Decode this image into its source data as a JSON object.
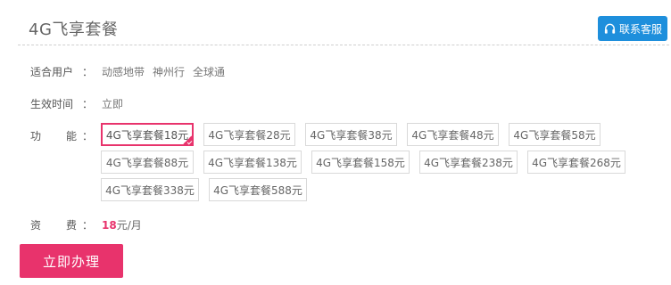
{
  "header": {
    "title": "4G飞享套餐",
    "service_label": "联系客服",
    "service_icon": "headset-icon",
    "brand_blue": "#1e8fdc"
  },
  "fields": {
    "users_label_a": "适合用户",
    "users_colon": "：",
    "users": [
      "动感地带",
      "神州行",
      "全球通"
    ],
    "effective_label": "生效时间",
    "effective_colon": "：",
    "effective_value": "立即",
    "function_label_a": "功",
    "function_label_b": "能",
    "function_colon": "：",
    "fee_label_a": "资",
    "fee_label_b": "费",
    "fee_colon": "：",
    "fee_value": "18",
    "fee_unit": "元/月"
  },
  "plans": [
    [
      {
        "label": "4G飞享套餐18元",
        "selected": true
      },
      {
        "label": "4G飞享套餐28元",
        "selected": false
      },
      {
        "label": "4G飞享套餐38元",
        "selected": false
      },
      {
        "label": "4G飞享套餐48元",
        "selected": false
      },
      {
        "label": "4G飞享套餐58元",
        "selected": false
      }
    ],
    [
      {
        "label": "4G飞享套餐88元",
        "selected": false
      },
      {
        "label": "4G飞享套餐138元",
        "selected": false
      },
      {
        "label": "4G飞享套餐158元",
        "selected": false
      },
      {
        "label": "4G飞享套餐238元",
        "selected": false
      },
      {
        "label": "4G飞享套餐268元",
        "selected": false
      }
    ],
    [
      {
        "label": "4G飞享套餐338元",
        "selected": false
      },
      {
        "label": "4G飞享套餐588元",
        "selected": false
      }
    ]
  ],
  "apply": {
    "label": "立即办理",
    "accent": "#e8336c"
  }
}
